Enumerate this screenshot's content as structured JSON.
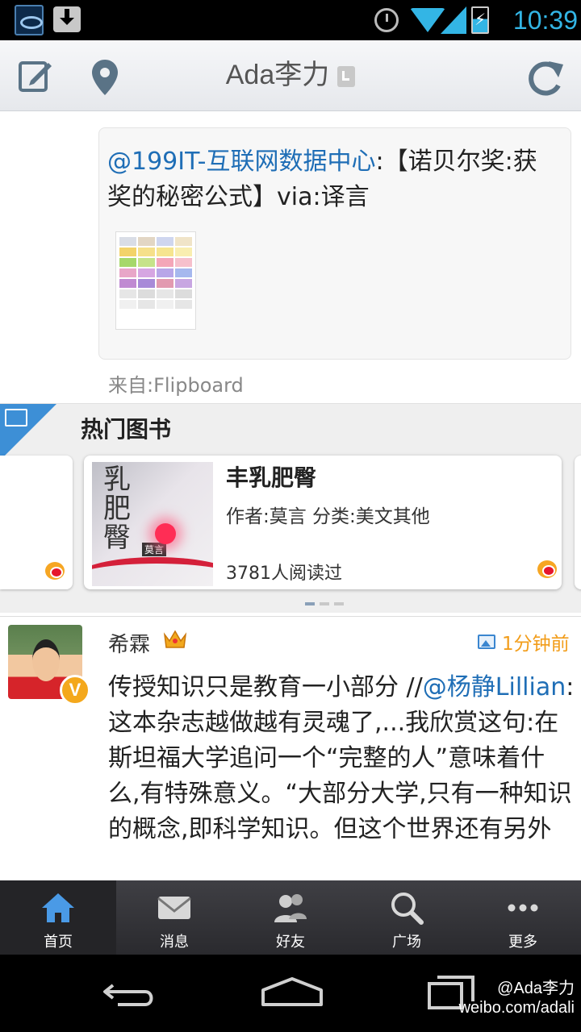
{
  "status_bar": {
    "time": "10:39"
  },
  "topbar": {
    "title": "Ada李力"
  },
  "repost": {
    "mention": "@199IT-互联网数据中心",
    "text": ":【诺贝尔奖:获奖的秘密公式】via:译言",
    "source": "来自:Flipboard"
  },
  "books_section": {
    "title": "热门图书",
    "book": {
      "name": "丰乳肥臀",
      "meta": "作者:莫言 分类:美文其他",
      "reads": "3781人阅读过"
    }
  },
  "feed_item": {
    "username": "希霖",
    "timestamp": "1分钟前",
    "text_part1": "传授知识只是教育一小部分 //",
    "mention": "@杨静Lillian",
    "text_part2": ":这本杂志越做越有灵魂了,...我欣赏这句:在斯坦福大学追问一个“完整的人”意味着什么,有特殊意义。“大部分大学,只有一种知识的概念,即科学知识。但这个世界还有另外"
  },
  "tabs": [
    {
      "label": "首页",
      "icon": "home-icon"
    },
    {
      "label": "消息",
      "icon": "mail-icon"
    },
    {
      "label": "好友",
      "icon": "friends-icon"
    },
    {
      "label": "广场",
      "icon": "search-icon"
    },
    {
      "label": "更多",
      "icon": "more-icon"
    }
  ],
  "watermark": {
    "line1": "@Ada李力",
    "line2": "weibo.com/adali"
  },
  "colors": {
    "accent": "#33b5e5",
    "link": "#1f6eb6",
    "time_orange": "#f29d1a",
    "tab_active": "#3d8fd6"
  }
}
